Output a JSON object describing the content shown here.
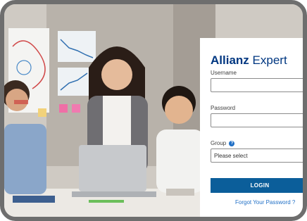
{
  "brand": {
    "name_bold": "Allianz",
    "name_light": "Expert",
    "color": "#003781"
  },
  "form": {
    "username_label": "Username",
    "username_value": "",
    "password_label": "Password",
    "password_value": "",
    "group_label": "Group",
    "group_help_icon": "help-circle-icon",
    "group_selected": "Please select"
  },
  "actions": {
    "login_label": "LOGIN",
    "login_color": "#0b5e9a",
    "forgot_label": "Forgot Your Password ?"
  }
}
